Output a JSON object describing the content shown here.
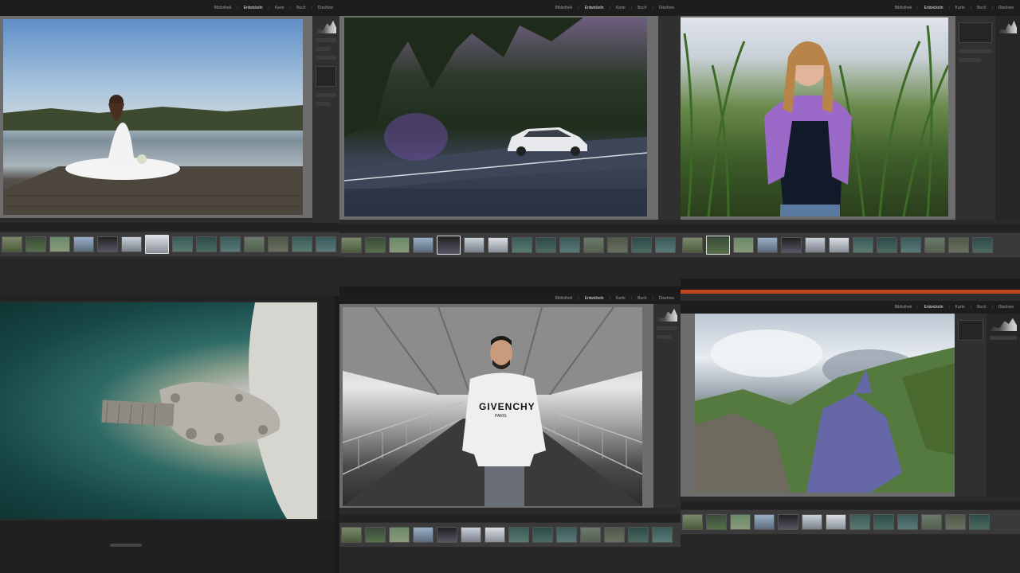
{
  "modules": [
    "Bibliothek",
    "Entwickeln",
    "Karte",
    "Buch",
    "Diashow"
  ],
  "modules_short": [
    "Bibliothek",
    "Entwickeln",
    "Karte",
    "Buch",
    "Diashow"
  ],
  "modules_alt": [
    "Bibliothek",
    "Entwickeln",
    "Karte",
    "Buch",
    "Diashow"
  ],
  "active_module": "Entwickeln",
  "shirt_text": {
    "brand": "GIVENCHY",
    "sub": "PARIS"
  },
  "colors": {
    "accent_bar": "#c0461f",
    "filmstrip": "#3a3a3a",
    "panel_bg": "#2a2a2a"
  },
  "icons": [
    "histogram-icon",
    "crop-tool-icon",
    "brush-icon"
  ]
}
